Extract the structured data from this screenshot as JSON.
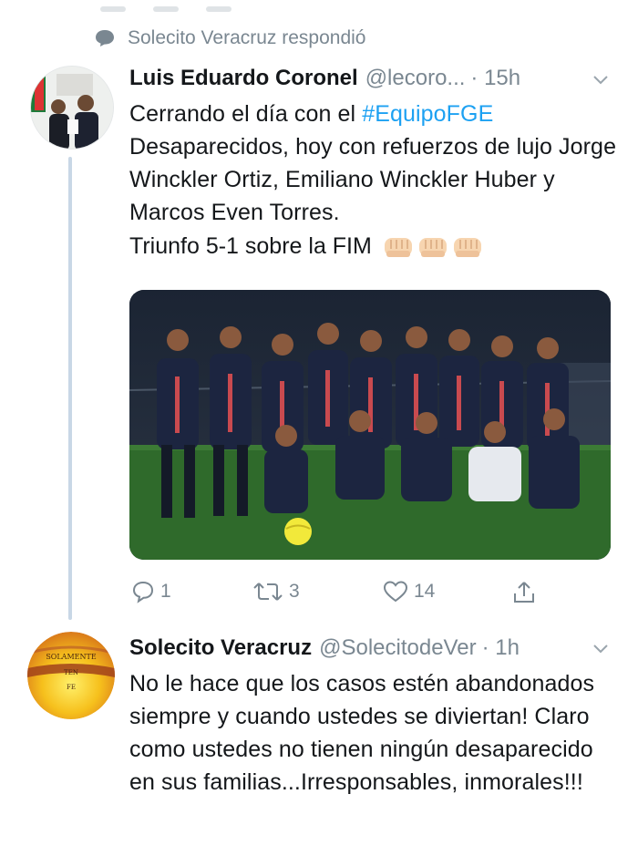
{
  "context": {
    "text": "Solecito Veracruz respondió"
  },
  "tweet1": {
    "name": "Luis Eduardo Coronel",
    "handle": "@lecoro...",
    "time": "· 15h",
    "text_before_tag": "Cerrando el día con el ",
    "hashtag": "#EquipoFGE",
    "text_after_tag": "Desaparecidos, hoy con refuerzos de lujo Jorge Winckler Ortiz, Emiliano Winckler Huber y Marcos Even Torres.",
    "line2": "Triunfo 5-1 sobre la FIM",
    "emoji": [
      "fist-icon",
      "fist-icon",
      "fist-icon"
    ],
    "replies": "1",
    "retweets": "3",
    "likes": "14"
  },
  "tweet2": {
    "name": "Solecito Veracruz",
    "handle": "@SolecitodeVer",
    "time": "· 1h",
    "text": "No le hace que los casos estén abandonados siempre y cuando ustedes se diviertan! Claro como ustedes no tienen ningún desaparecido en sus familias...Irresponsables, inmorales!!!",
    "avatar_text": [
      "SOLAMENTE",
      "TEN",
      "FE"
    ]
  },
  "colors": {
    "link": "#1da1f2",
    "muted": "#7a8791",
    "thread": "#c8d7e6"
  }
}
